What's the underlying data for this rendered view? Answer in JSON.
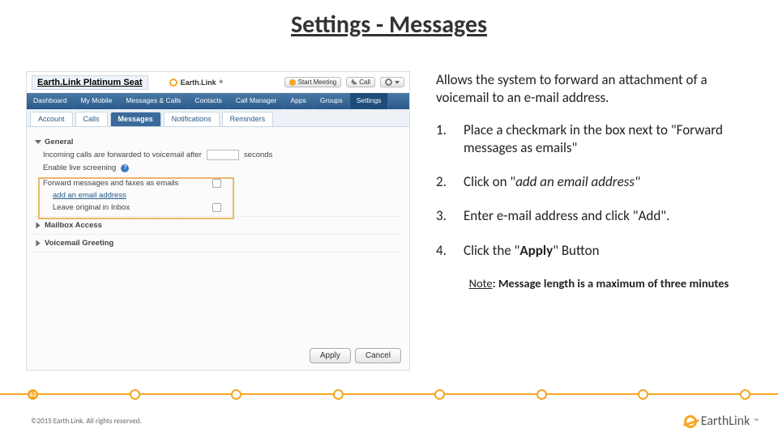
{
  "slide_title": "Settings - Messages",
  "shot": {
    "seat_label": "Earth.Link Platinum Seat",
    "brand": "Earth.Link",
    "btn_start": "Start Meeting",
    "btn_call": "Call",
    "nav1": [
      "Dashboard",
      "My Mobile",
      "Messages & Calls",
      "Contacts",
      "Call Manager",
      "Apps",
      "Groups",
      "Settings"
    ],
    "nav1_active": 7,
    "nav2": [
      "Account",
      "Calls",
      "Messages",
      "Notifications",
      "Reminders"
    ],
    "nav2_active": 2,
    "general": "General",
    "line_fwd1": "Incoming calls are forwarded to voicemail after",
    "line_fwd2": "seconds",
    "enable_screen": "Enable live screening",
    "fwd_as_email": "Forward messages and faxes as emails",
    "add_link": "add an email address",
    "leave_orig": "Leave original in Inbox",
    "mailbox": "Mailbox Access",
    "vm_greet": "Voicemail Greeting",
    "apply": "Apply",
    "cancel": "Cancel"
  },
  "instr": {
    "intro": "Allows the system to forward an attachment of a voicemail to an e-mail address.",
    "steps": {
      "s1": "Place a checkmark in the box next to \"Forward messages as emails\"",
      "s2_a": "Click on \"",
      "s2_i": "add an email address\"",
      "s3": "Enter e-mail address and click \"Add\".",
      "s4_a": "Click the \"",
      "s4_b": "Apply",
      "s4_c": "\" Button"
    },
    "note_label": "Note",
    "note_text": ": Message length is a maximum of three minutes"
  },
  "footer": {
    "page": "63",
    "copy": "©2015 Earth.Link. All rights reserved.",
    "logo": "EarthLink"
  }
}
